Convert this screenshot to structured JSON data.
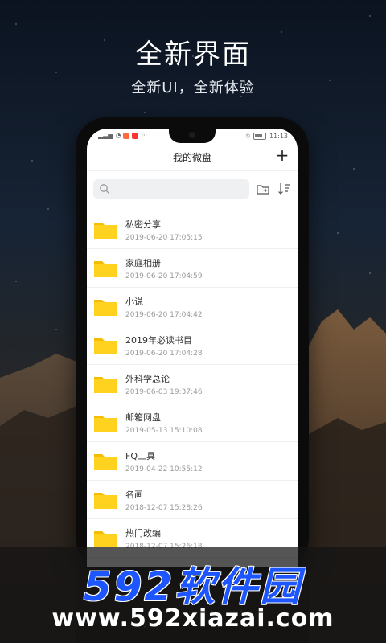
{
  "hero": {
    "title": "全新界面",
    "subtitle": "全新UI，全新体验"
  },
  "status_bar": {
    "time": "11:13",
    "dots": "···"
  },
  "app": {
    "title": "我的微盘",
    "add_label": "+"
  },
  "search": {
    "placeholder": ""
  },
  "files": [
    {
      "name": "私密分享",
      "date": "2019-06-20 17:05:15"
    },
    {
      "name": "家庭相册",
      "date": "2019-06-20 17:04:59"
    },
    {
      "name": "小说",
      "date": "2019-06-20 17:04:42"
    },
    {
      "name": "2019年必读书目",
      "date": "2019-06-20 17:04:28"
    },
    {
      "name": "外科学总论",
      "date": "2019-06-03 19:37:46"
    },
    {
      "name": "邮箱网盘",
      "date": "2019-05-13 15:10:08"
    },
    {
      "name": "FQ工具",
      "date": "2019-04-22 10:55:12"
    },
    {
      "name": "名画",
      "date": "2018-12-07 15:28:26"
    },
    {
      "name": "热门改编",
      "date": "2018-12-07 15:26:18"
    }
  ],
  "watermark": {
    "logo": "592软件园",
    "url": "www.592xiazai.com"
  },
  "colors": {
    "folder": "#FFD21F",
    "folder_tab": "#F5BD00",
    "watermark_blue": "#1D55FF"
  }
}
